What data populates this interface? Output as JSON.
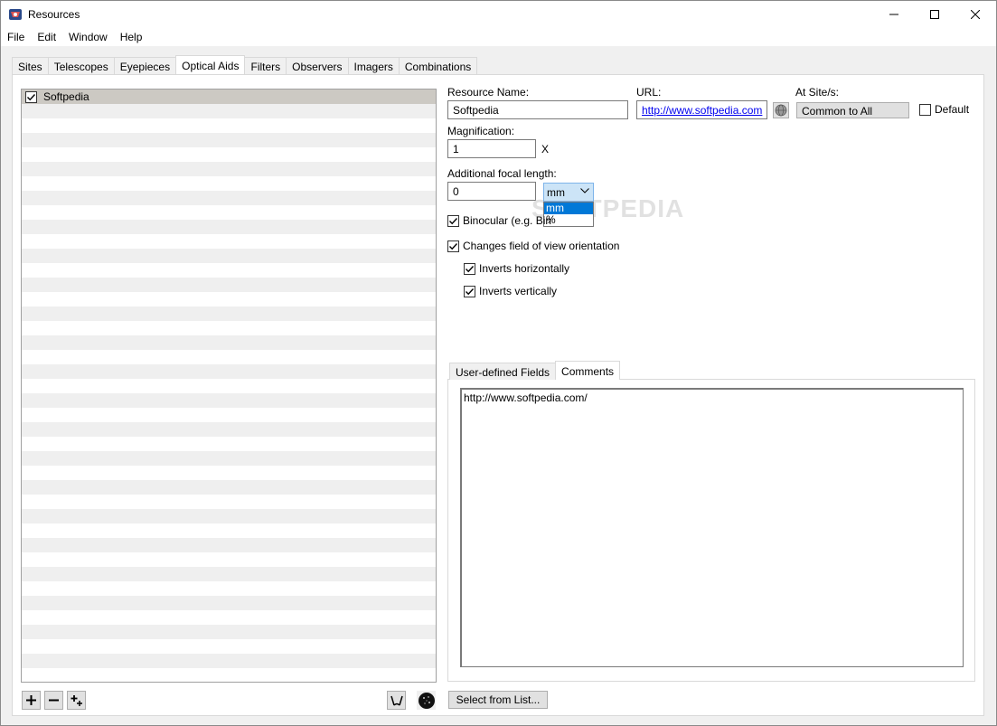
{
  "window": {
    "title": "Resources"
  },
  "menu": [
    "File",
    "Edit",
    "Window",
    "Help"
  ],
  "tabs": [
    "Sites",
    "Telescopes",
    "Eyepieces",
    "Optical Aids",
    "Filters",
    "Observers",
    "Imagers",
    "Combinations"
  ],
  "active_tab": "Optical Aids",
  "list": {
    "items": [
      {
        "label": "Softpedia",
        "checked": true
      }
    ]
  },
  "form": {
    "resource_name_label": "Resource Name:",
    "resource_name_value": "Softpedia",
    "url_label": "URL:",
    "url_value": "http://www.softpedia.com",
    "at_sites_label": "At Site/s:",
    "at_sites_value": "Common to All",
    "default_label": "Default",
    "magnification_label": "Magnification:",
    "magnification_value": "1",
    "magnification_unit": "X",
    "focal_label": "Additional focal length:",
    "focal_value": "0",
    "focal_unit_selected": "mm",
    "focal_unit_options": [
      "mm",
      "%"
    ],
    "binocular_label": "Binocular (e.g. Bin",
    "changes_fov_label": "Changes field of view orientation",
    "inverts_h_label": "Inverts horizontally",
    "inverts_v_label": "Inverts vertically"
  },
  "subtabs": [
    "User-defined Fields",
    "Comments"
  ],
  "active_subtab": "Comments",
  "comments_text": "http://www.softpedia.com/",
  "buttons": {
    "select_from_list": "Select from List..."
  },
  "watermark": "SOFTPEDIA"
}
